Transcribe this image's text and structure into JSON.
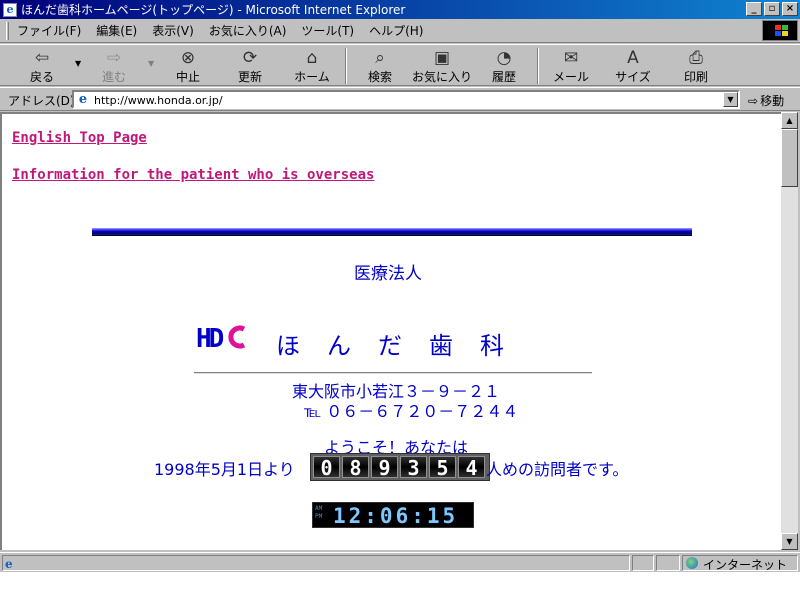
{
  "window": {
    "title": "ほんだ歯科ホームページ(トップページ) - Microsoft Internet Explorer",
    "buttons": {
      "minimize": "_",
      "restore": "▫",
      "close": "×"
    }
  },
  "menu": [
    "ファイル(F)",
    "編集(E)",
    "表示(V)",
    "お気に入り(A)",
    "ツール(T)",
    "ヘルプ(H)"
  ],
  "toolbar": {
    "back": "戻る",
    "forward": "進む",
    "stop": "中止",
    "refresh": "更新",
    "home": "ホーム",
    "search": "検索",
    "favorites": "お気に入り",
    "history": "履歴",
    "mail": "メール",
    "size": "サイズ",
    "print": "印刷"
  },
  "address": {
    "label": "アドレス(D)",
    "url": "http://www.honda.or.jp/",
    "go": "移動"
  },
  "page": {
    "links": {
      "english": "English Top Page",
      "overseas": "Information for the patient who is overseas"
    },
    "org_type": "医療法人",
    "logo_letters": "HD",
    "clinic_name": "ほんだ歯科",
    "address_line": "東大阪市小若江３－９－２１",
    "tel_line": "℡ ０６－６７２０－７２４４",
    "welcome": "ようこそ！あなたは",
    "since": "1998年5月1日より",
    "counter_digits": [
      "0",
      "8",
      "9",
      "3",
      "5",
      "4"
    ],
    "visitor_suffix": "人めの訪問者です。",
    "clock": {
      "am": "AM",
      "pm": "PM",
      "time": "12:06:15"
    }
  },
  "status": {
    "zone": "インターネット"
  },
  "colors": {
    "link": "#c0187a",
    "text": "#0000c8",
    "titlebar": "#00007b"
  }
}
